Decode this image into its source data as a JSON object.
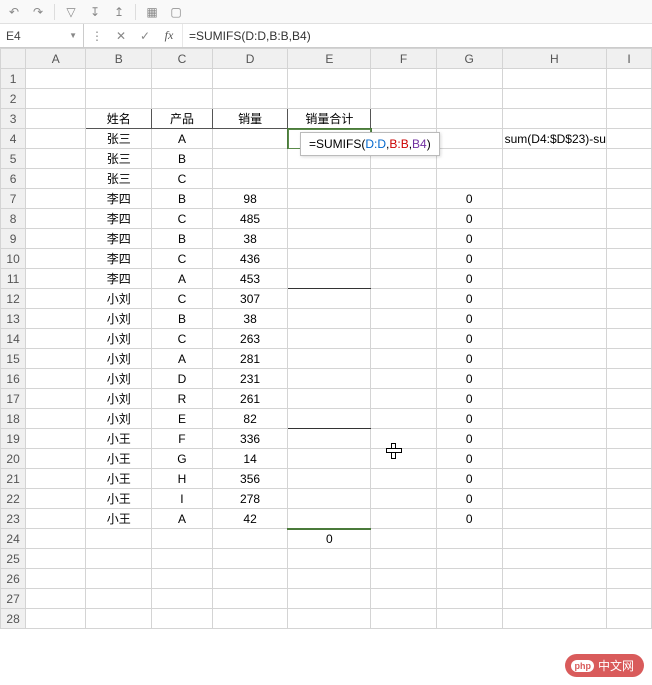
{
  "toolbar": {
    "icons": [
      "undo",
      "redo",
      "filter",
      "sort-desc",
      "sort-asc",
      "grid",
      "border"
    ]
  },
  "namebox": "E4",
  "formula_bar": "=SUMIFS(D:D,B:B,B4)",
  "tooltip": {
    "prefix": "=SUMIFS(",
    "arg1": "D:D",
    "arg2": "B:B",
    "arg3": "B4",
    "suffix": ")"
  },
  "columns": [
    "A",
    "B",
    "C",
    "D",
    "E",
    "F",
    "G",
    "H",
    "I"
  ],
  "rows": [
    1,
    2,
    3,
    4,
    5,
    6,
    7,
    8,
    9,
    10,
    11,
    12,
    13,
    14,
    15,
    16,
    17,
    18,
    19,
    20,
    21,
    22,
    23,
    24,
    25,
    26,
    27,
    28
  ],
  "headers": {
    "B3": "姓名",
    "C3": "产品",
    "D3": "销量",
    "E3": "销量合计"
  },
  "data": [
    {
      "row": 4,
      "name": "张三",
      "prod": "A",
      "sales": "",
      "g": ""
    },
    {
      "row": 5,
      "name": "张三",
      "prod": "B",
      "sales": "",
      "g": ""
    },
    {
      "row": 6,
      "name": "张三",
      "prod": "C",
      "sales": "",
      "g": ""
    },
    {
      "row": 7,
      "name": "李四",
      "prod": "B",
      "sales": "98",
      "g": "0"
    },
    {
      "row": 8,
      "name": "李四",
      "prod": "C",
      "sales": "485",
      "g": "0"
    },
    {
      "row": 9,
      "name": "李四",
      "prod": "B",
      "sales": "38",
      "g": "0"
    },
    {
      "row": 10,
      "name": "李四",
      "prod": "C",
      "sales": "436",
      "g": "0"
    },
    {
      "row": 11,
      "name": "李四",
      "prod": "A",
      "sales": "453",
      "g": "0"
    },
    {
      "row": 12,
      "name": "小刘",
      "prod": "C",
      "sales": "307",
      "g": "0"
    },
    {
      "row": 13,
      "name": "小刘",
      "prod": "B",
      "sales": "38",
      "g": "0"
    },
    {
      "row": 14,
      "name": "小刘",
      "prod": "C",
      "sales": "263",
      "g": "0"
    },
    {
      "row": 15,
      "name": "小刘",
      "prod": "A",
      "sales": "281",
      "g": "0"
    },
    {
      "row": 16,
      "name": "小刘",
      "prod": "D",
      "sales": "231",
      "g": "0"
    },
    {
      "row": 17,
      "name": "小刘",
      "prod": "R",
      "sales": "261",
      "g": "0"
    },
    {
      "row": 18,
      "name": "小刘",
      "prod": "E",
      "sales": "82",
      "g": "0"
    },
    {
      "row": 19,
      "name": "小王",
      "prod": "F",
      "sales": "336",
      "g": "0"
    },
    {
      "row": 20,
      "name": "小王",
      "prod": "G",
      "sales": "14",
      "g": "0"
    },
    {
      "row": 21,
      "name": "小王",
      "prod": "H",
      "sales": "356",
      "g": "0"
    },
    {
      "row": 22,
      "name": "小王",
      "prod": "I",
      "sales": "278",
      "g": "0"
    },
    {
      "row": 23,
      "name": "小王",
      "prod": "A",
      "sales": "42",
      "g": "0"
    }
  ],
  "extra": {
    "H4": "sum(D4:$D$23)-su",
    "E24": "0"
  },
  "watermark": "中文网",
  "watermark_logo": "php"
}
